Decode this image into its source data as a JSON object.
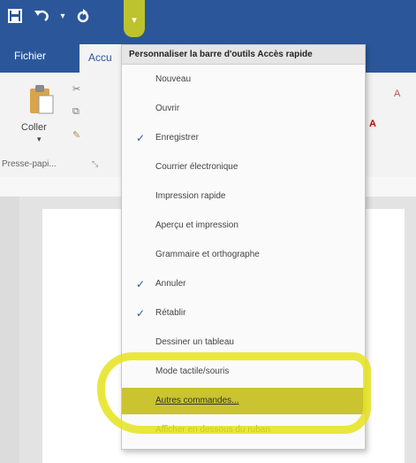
{
  "qat": {
    "save_icon": "save-icon",
    "undo_icon": "undo-icon",
    "redo_icon": "redo-icon",
    "customize_icon": "chevron-down-icon"
  },
  "tabs": {
    "file": "Fichier",
    "home": "Accu"
  },
  "ribbon": {
    "paste_label": "Coller",
    "clipboard_group": "Presse-papi..."
  },
  "menu": {
    "title": "Personnaliser la barre d'outils Accès rapide",
    "items": [
      {
        "label": "Nouveau",
        "checked": false
      },
      {
        "label": "Ouvrir",
        "checked": false
      },
      {
        "label": "Enregistrer",
        "checked": true
      },
      {
        "label": "Courrier électronique",
        "checked": false
      },
      {
        "label": "Impression rapide",
        "checked": false
      },
      {
        "label": "Aperçu et impression",
        "checked": false
      },
      {
        "label": "Grammaire et orthographe",
        "checked": false
      },
      {
        "label": "Annuler",
        "checked": true
      },
      {
        "label": "Rétablir",
        "checked": true
      },
      {
        "label": "Dessiner un tableau",
        "checked": false
      },
      {
        "label": "Mode tactile/souris",
        "checked": false
      },
      {
        "label": "Autres commandes...",
        "checked": false
      },
      {
        "label": "Afficher en dessous du ruban",
        "checked": false
      }
    ],
    "check_glyph": "✓"
  },
  "colors": {
    "accent": "#2b579a",
    "highlight": "#e5e31d"
  }
}
